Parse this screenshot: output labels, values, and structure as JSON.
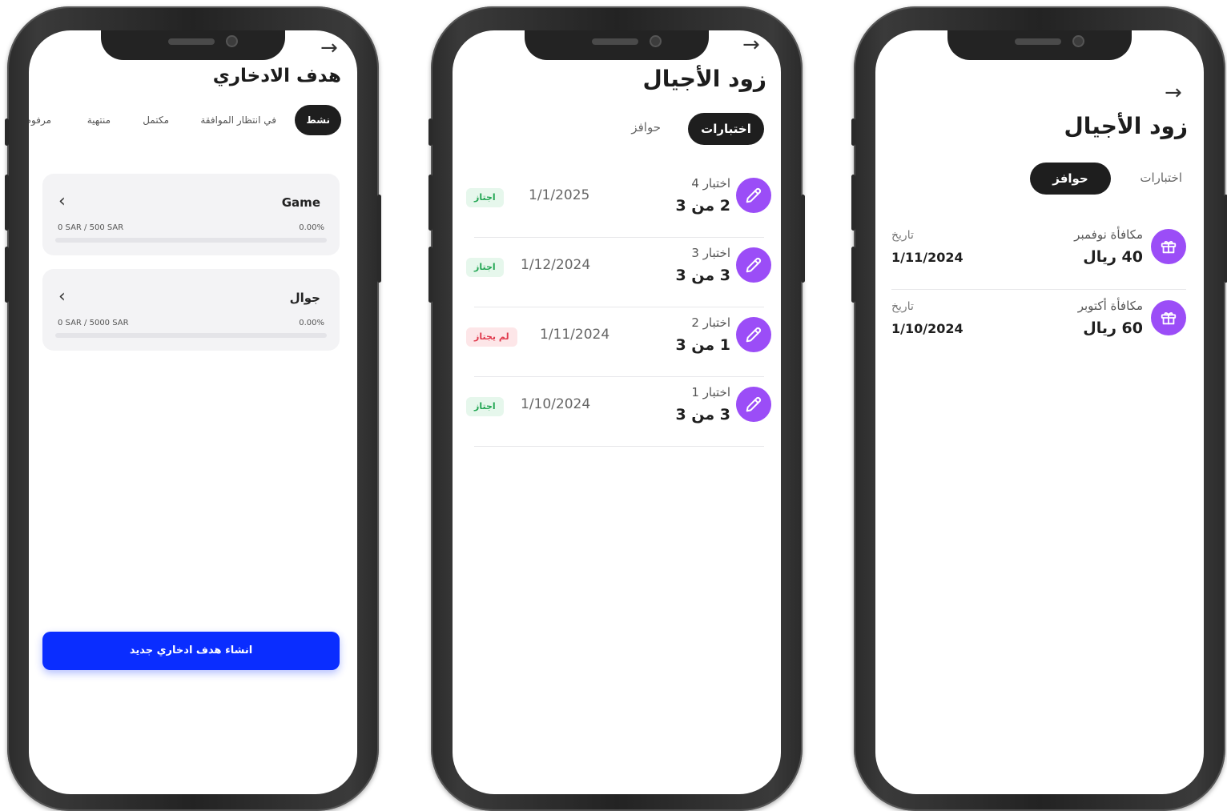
{
  "screens": [
    {
      "title": "هدف الادخاري",
      "tabs": [
        "نشط",
        "في انتظار الموافقة",
        "مكتمل",
        "منتهية",
        "مرفوض"
      ],
      "goals": [
        {
          "name": "Game",
          "amount": "0 SAR / 500 SAR",
          "percent": "0.00%",
          "progress": 0
        },
        {
          "name": "جوال",
          "amount": "0 SAR / 5000 SAR",
          "percent": "0.00%",
          "progress": 0
        }
      ],
      "create_button": "انشاء هدف ادخاري جديد"
    },
    {
      "title": "زود الأجيال",
      "tab_active": "اختبارات",
      "tab_other": "حوافز",
      "tests": [
        {
          "name": "اختبار 4",
          "score": "2 من 3",
          "date": "1/1/2025",
          "status": "اجتاز",
          "passed": true
        },
        {
          "name": "اختبار 3",
          "score": "3 من 3",
          "date": "1/12/2024",
          "status": "اجتاز",
          "passed": true
        },
        {
          "name": "اختبار 2",
          "score": "1 من 3",
          "date": "1/11/2024",
          "status": "لم يجتاز",
          "passed": false
        },
        {
          "name": "اختبار 1",
          "score": "3 من 3",
          "date": "1/10/2024",
          "status": "اجتاز",
          "passed": true
        }
      ]
    },
    {
      "title": "زود الأجيال",
      "tab_active": "حوافز",
      "tab_other": "اختبارات",
      "rewards": [
        {
          "name": "مكافأة نوفمبر",
          "amount": "40 ريال",
          "date_label": "تاريخ",
          "date": "1/11/2024"
        },
        {
          "name": "مكافأة أكتوبر",
          "amount": "60 ريال",
          "date_label": "تاريخ",
          "date": "1/10/2024"
        }
      ]
    }
  ],
  "icons": {
    "back": "arrow-right-icon",
    "test": "pencil-icon",
    "reward": "gift-icon",
    "chevron": "chevron-left-icon"
  },
  "colors": {
    "accent": "#0a2dff",
    "purple": "#9b4df7",
    "dark": "#1e1e1e",
    "pass": "#22a653",
    "fail": "#e0394c"
  }
}
